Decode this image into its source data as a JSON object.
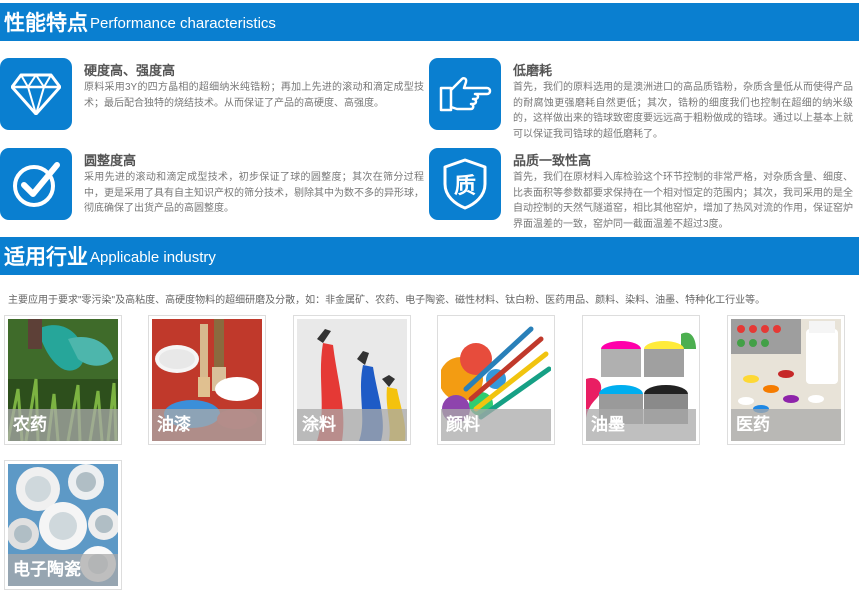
{
  "sections": {
    "performance": {
      "title_zh": "性能特点",
      "title_en": "Performance characteristics"
    },
    "industry": {
      "title_zh": "适用行业",
      "title_en": "Applicable industry"
    }
  },
  "features": [
    {
      "title": "硬度高、强度高",
      "desc": "原料采用3Y的四方晶相的超细纳米纯锆粉；再加上先进的滚动和滴定成型技术；最后配合独特的烧结技术。从而保证了产品的高硬度、高强度。",
      "icon": "diamond-icon"
    },
    {
      "title": "低磨耗",
      "desc": "首先，我们的原料选用的是澳洲进口的高品质锆粉，杂质含量低从而使得产品的耐腐蚀更强磨耗自然更低；其次，锆粉的细度我们也控制在超细的纳米级的，这样做出来的锆球致密度要远远高于粗粉做成的锆球。通过以上基本上就可以保证我司锆球的超低磨耗了。",
      "icon": "pointing-hand-icon"
    },
    {
      "title": "圆整度高",
      "desc": "采用先进的滚动和滴定成型技术，初步保证了球的圆整度；其次在筛分过程中，更是采用了具有自主知识产权的筛分技术，剔除其中为数不多的异形球，彻底确保了出货产品的高圆整度。",
      "icon": "checkmark-icon"
    },
    {
      "title": "品质一致性高",
      "desc": "首先，我们在原材料入库检验这个环节控制的非常严格，对杂质含量、细度、比表面积等参数都要求保持在一个相对恒定的范围内；其次，我司采用的是全自动控制的天然气隧道窑，相比其他窑炉，增加了热风对流的作用，保证窑炉界面温差的一致，窑炉同一截面温差不超过3度。",
      "icon": "quality-badge-icon",
      "icon_text": "质"
    }
  ],
  "industry_intro": "主要应用于要求\"零污染\"及高粘度、高硬度物料的超细研磨及分散，如：非金属矿、农药、电子陶瓷、磁性材料、钛白粉、医药用品、颜料、染料、油墨、特种化工行业等。",
  "industries": [
    {
      "label": "农药"
    },
    {
      "label": "油漆"
    },
    {
      "label": "涂料"
    },
    {
      "label": "颜料"
    },
    {
      "label": "油墨"
    },
    {
      "label": "医药"
    },
    {
      "label": "电子陶瓷"
    }
  ],
  "colors": {
    "brand_blue": "#0a7fd0",
    "caption_overlay": "#aaaaaa"
  }
}
